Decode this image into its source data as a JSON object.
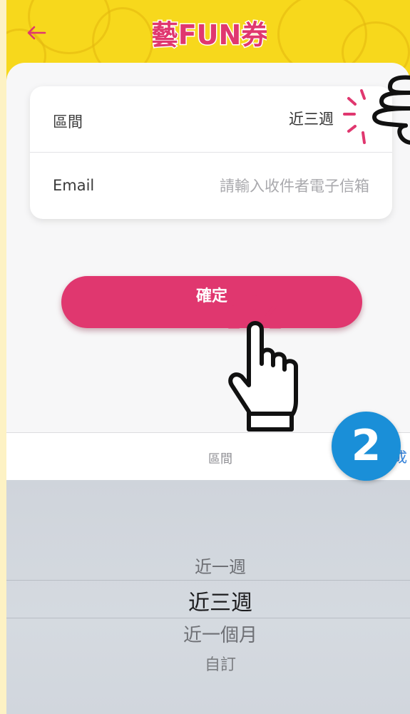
{
  "header": {
    "logo_text": "藝FUN券"
  },
  "form": {
    "interval_label": "區間",
    "interval_value": "近三週",
    "email_label": "Email",
    "email_placeholder": "請輸入收件者電子信箱",
    "email_value": ""
  },
  "confirm_label": "確定",
  "picker": {
    "title": "區間",
    "done_label": "成",
    "options": [
      "近一週",
      "近三週",
      "近一個月",
      "自訂"
    ],
    "selected_index": 1
  },
  "step_badge": "2",
  "colors": {
    "header_yellow": "#f7d81c",
    "accent_pink": "#e0376f",
    "badge_blue": "#1a8fd8"
  }
}
